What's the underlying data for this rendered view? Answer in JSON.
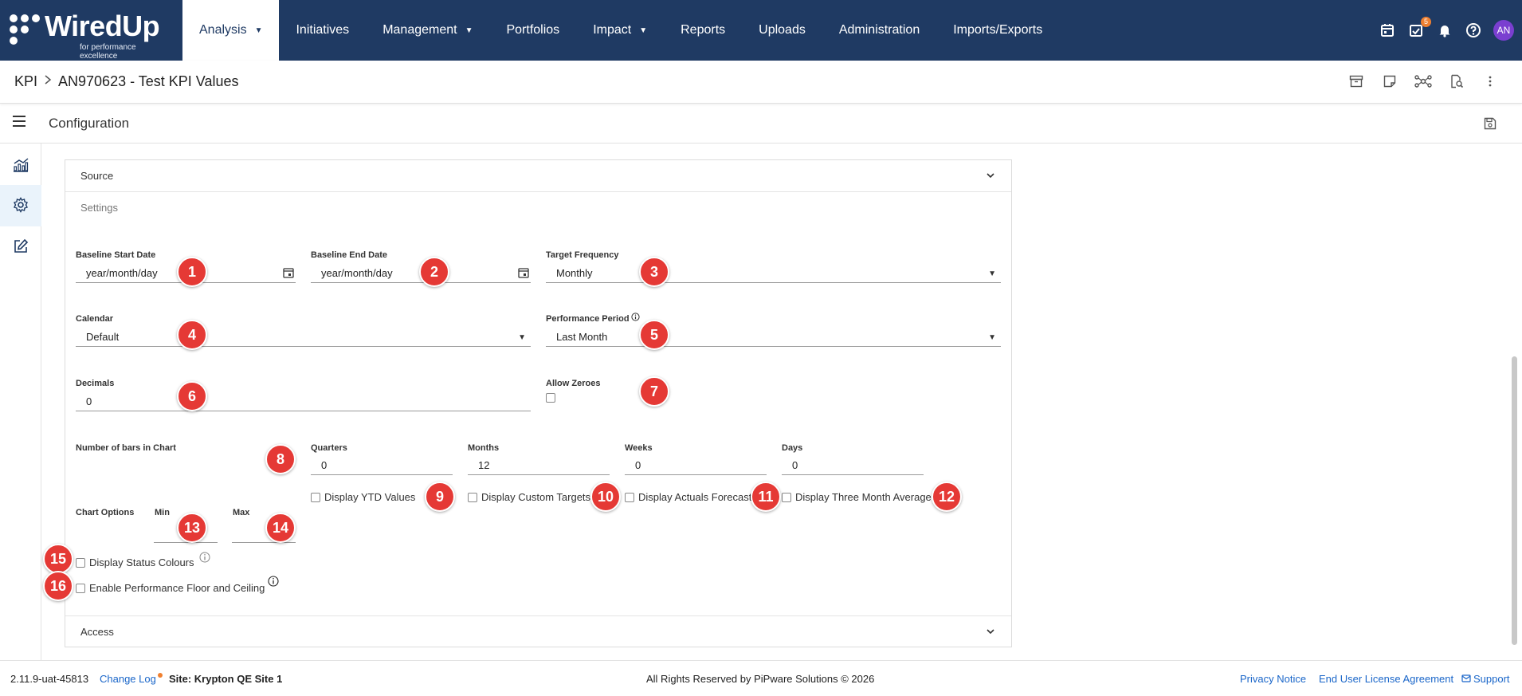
{
  "nav": {
    "logo_text": "WiredUp",
    "logo_sub": "for performance excellence",
    "items": [
      {
        "label": "Analysis",
        "caret": "▼"
      },
      {
        "label": "Initiatives",
        "caret": ""
      },
      {
        "label": "Management",
        "caret": "▼"
      },
      {
        "label": "Portfolios",
        "caret": ""
      },
      {
        "label": "Impact",
        "caret": "▼"
      },
      {
        "label": "Reports",
        "caret": ""
      },
      {
        "label": "Uploads",
        "caret": ""
      },
      {
        "label": "Administration",
        "caret": ""
      },
      {
        "label": "Imports/Exports",
        "caret": ""
      }
    ],
    "tasks_badge": "5",
    "avatar": "AN"
  },
  "breadcrumb": {
    "root": "KPI",
    "current": "AN970623 - Test KPI Values"
  },
  "config": {
    "title": "Configuration"
  },
  "sections": {
    "source": "Source",
    "settings": "Settings",
    "access": "Access"
  },
  "form": {
    "baseline_start_label": "Baseline Start Date",
    "baseline_start_value": "year/month/day",
    "baseline_end_label": "Baseline End Date",
    "baseline_end_value": "year/month/day",
    "target_freq_label": "Target Frequency",
    "target_freq_value": "Monthly",
    "calendar_label": "Calendar",
    "calendar_value": "Default",
    "perf_period_label": "Performance Period",
    "perf_period_value": "Last Month",
    "decimals_label": "Decimals",
    "decimals_value": "0",
    "allow_zeroes_label": "Allow Zeroes",
    "bars_label": "Number of bars in Chart",
    "quarters_label": "Quarters",
    "quarters_value": "0",
    "months_label": "Months",
    "months_value": "12",
    "weeks_label": "Weeks",
    "weeks_value": "0",
    "days_label": "Days",
    "days_value": "0",
    "ytd_label": "Display YTD Values",
    "custom_targets_label": "Display Custom Targets",
    "actuals_forecast_label": "Display Actuals Forecast",
    "three_month_label": "Display Three Month Average",
    "chart_options_label": "Chart Options",
    "min_label": "Min",
    "max_label": "Max",
    "status_colours_label": "Display Status Colours",
    "floor_ceiling_label": "Enable Performance Floor and Ceiling"
  },
  "markers": [
    "1",
    "2",
    "3",
    "4",
    "5",
    "6",
    "7",
    "8",
    "9",
    "10",
    "11",
    "12",
    "13",
    "14",
    "15",
    "16"
  ],
  "footer": {
    "version": "2.11.9-uat-45813",
    "changelog": "Change Log",
    "site": "Site: Krypton QE Site 1",
    "rights": "All Rights Reserved by PiPware Solutions © 2026",
    "privacy": "Privacy Notice",
    "eula": "End User License Agreement",
    "support": "Support"
  },
  "colors": {
    "nav_bg": "#1f3a63",
    "marker": "#e53935",
    "link": "#1a66c9",
    "badge": "#f08030"
  }
}
